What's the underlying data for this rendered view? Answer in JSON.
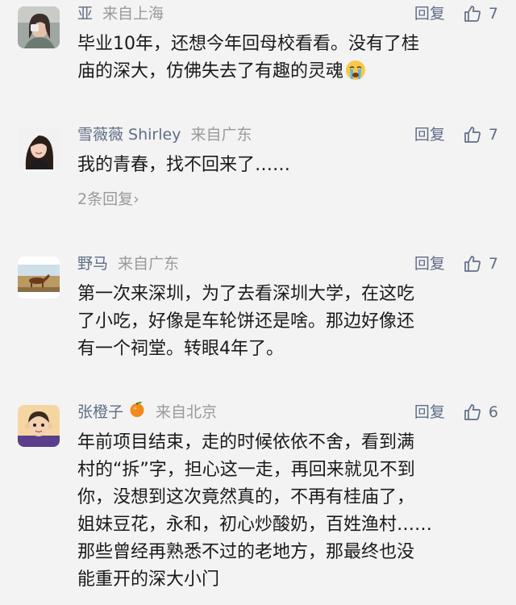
{
  "comments": [
    {
      "name": "亚",
      "location": "来自上海",
      "reply_label": "回复",
      "likes": "7",
      "text": "毕业10年，还想今年回母校看看。没有了桂\n庙的深大，仿佛失去了有趣的灵魂",
      "emoji": "crying-face-icon"
    },
    {
      "name": "雪薇薇 Shirley",
      "location": "来自广东",
      "reply_label": "回复",
      "likes": "7",
      "text": "我的青春，找不回来了……",
      "more_replies": "2条回复›"
    },
    {
      "name": "野马",
      "location": "来自广东",
      "reply_label": "回复",
      "likes": "7",
      "text": "第一次来深圳，为了去看深圳大学，在这吃\n了小吃，好像是车轮饼还是啥。那边好像还\n有一个祠堂。转眼4年了。"
    },
    {
      "name": "张橙子",
      "location": "来自北京",
      "reply_label": "回复",
      "likes": "6",
      "name_icon": "tangerine-icon",
      "text": "年前项目结束，走的时候依依不舍，看到满\n村的“拆”字，担心这一走，再回来就见不到\n你，没想到这次竟然真的，不再有桂庙了，\n姐妹豆花，永和，初心炒酸奶，百姓渔村……\n那些曾经再熟悉不过的老地方，那最终也没\n能重开的深大小门"
    }
  ],
  "colors": {
    "background": "#f3f3f3",
    "name": "#5f6e86",
    "meta": "#9a9a9a",
    "text": "#1a1a1a"
  }
}
